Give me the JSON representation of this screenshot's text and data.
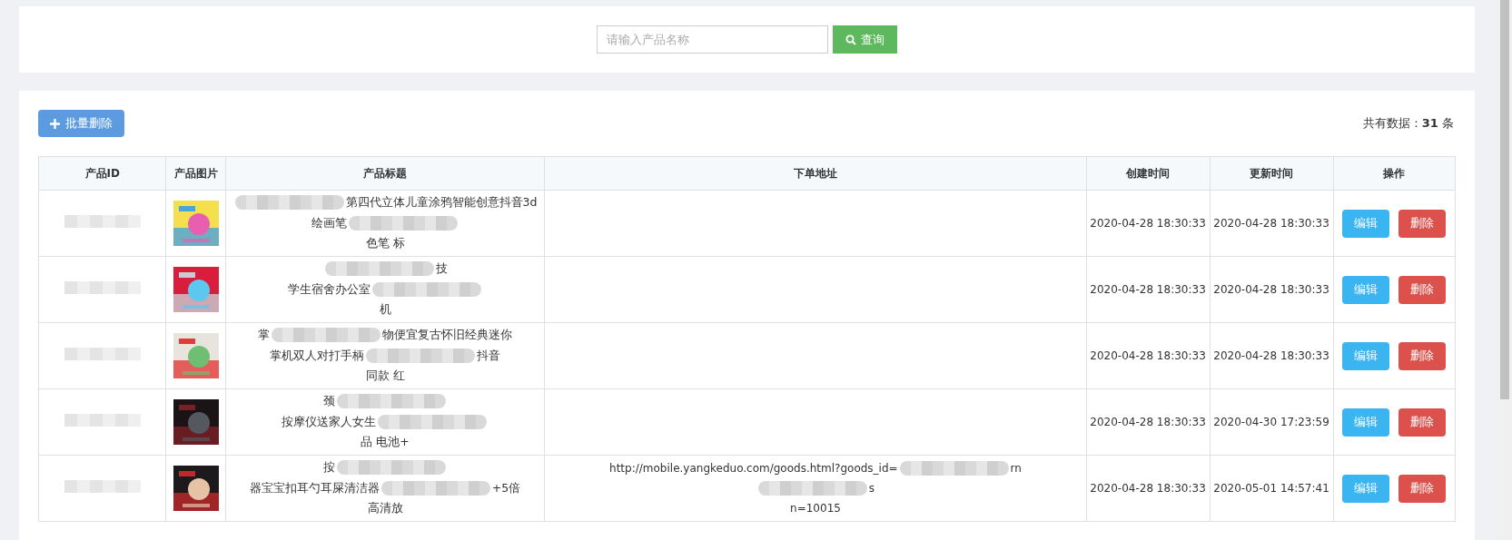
{
  "search": {
    "placeholder": "请输入产品名称",
    "button": "查询"
  },
  "toolbar": {
    "batch_delete": "批量删除",
    "total": "共有数据：**31** 条"
  },
  "table": {
    "columns": [
      "产品ID",
      "产品图片",
      "产品标题",
      "下单地址",
      "创建时间",
      "更新时间",
      "操作"
    ],
    "rows": [
      {
        "id_blurred": true,
        "image": {
          "kind": "picture"
        },
        "title_lines": [
          [
            {
              "kind": "blur"
            },
            {
              "kind": "text",
              "text": "第四代立体儿童涂鸦智能创意抖音3d"
            }
          ],
          [
            {
              "kind": "text",
              "text": "绘画笔"
            },
            {
              "kind": "blur"
            }
          ],
          [
            {
              "kind": "text",
              "text": "色笔 标"
            }
          ]
        ],
        "url_lines": [],
        "created": "2020-04-28 18:30:33",
        "updated": "2020-04-28 18:30:33",
        "actions": [
          "编辑",
          "删除"
        ]
      },
      {
        "id_blurred": true,
        "image": {
          "kind": "picture"
        },
        "title_lines": [
          [
            {
              "kind": "blur"
            },
            {
              "kind": "text",
              "text": "技"
            }
          ],
          [
            {
              "kind": "text",
              "text": "学生宿舍办公室"
            },
            {
              "kind": "blur"
            }
          ],
          [
            {
              "kind": "text",
              "text": "机"
            }
          ]
        ],
        "url_lines": [],
        "created": "2020-04-28 18:30:33",
        "updated": "2020-04-28 18:30:33",
        "actions": [
          "编辑",
          "删除"
        ]
      },
      {
        "id_blurred": true,
        "image": {
          "kind": "picture"
        },
        "title_lines": [
          [
            {
              "kind": "text",
              "text": "掌"
            },
            {
              "kind": "blur"
            },
            {
              "kind": "text",
              "text": "物便宜复古怀旧经典迷你"
            }
          ],
          [
            {
              "kind": "text",
              "text": "掌机双人对打手柄"
            },
            {
              "kind": "blur"
            },
            {
              "kind": "text",
              "text": "抖音"
            }
          ],
          [
            {
              "kind": "text",
              "text": "同款 红"
            }
          ]
        ],
        "url_lines": [],
        "created": "2020-04-28 18:30:33",
        "updated": "2020-04-28 18:30:33",
        "actions": [
          "编辑",
          "删除"
        ]
      },
      {
        "id_blurred": true,
        "image": {
          "kind": "picture"
        },
        "title_lines": [
          [
            {
              "kind": "text",
              "text": "颈"
            },
            {
              "kind": "blur"
            }
          ],
          [
            {
              "kind": "text",
              "text": "按摩仪送家人女生"
            },
            {
              "kind": "blur"
            }
          ],
          [
            {
              "kind": "text",
              "text": "品 电池+"
            }
          ]
        ],
        "url_lines": [],
        "created": "2020-04-28 18:30:33",
        "updated": "2020-04-30 17:23:59",
        "actions": [
          "编辑",
          "删除"
        ]
      },
      {
        "id_blurred": true,
        "image": {
          "kind": "picture"
        },
        "title_lines": [
          [
            {
              "kind": "text",
              "text": "按"
            },
            {
              "kind": "blur"
            }
          ],
          [
            {
              "kind": "text",
              "text": "器宝宝扣耳勺耳屎清洁器"
            },
            {
              "kind": "blur"
            },
            {
              "kind": "text",
              "text": "+5倍"
            }
          ],
          [
            {
              "kind": "text",
              "text": "高清放"
            }
          ]
        ],
        "url_lines": [
          [
            {
              "kind": "text",
              "text": "http://mobile.yangkeduo.com/goods.html?goods_id="
            },
            {
              "kind": "blur"
            },
            {
              "kind": "text",
              "text": "rn"
            }
          ],
          [
            {
              "kind": "blur"
            },
            {
              "kind": "text",
              "text": "s"
            }
          ],
          [
            {
              "kind": "text",
              "text": "n=10015"
            }
          ]
        ],
        "created": "2020-04-28 18:30:33",
        "updated": "2020-05-01 14:57:41",
        "actions": [
          "编辑",
          "删除"
        ]
      }
    ]
  }
}
